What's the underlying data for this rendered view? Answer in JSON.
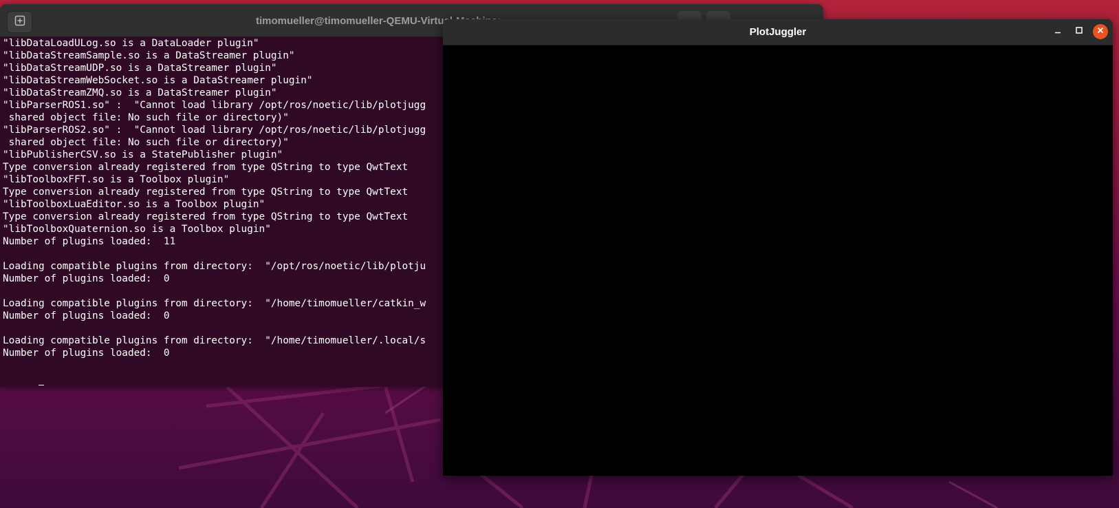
{
  "terminal": {
    "title": "timomueller@timomueller-QEMU-Virtual-Machine: ~",
    "lines": [
      "\"libDataLoadULog.so is a DataLoader plugin\"",
      "\"libDataStreamSample.so is a DataStreamer plugin\"",
      "\"libDataStreamUDP.so is a DataStreamer plugin\"",
      "\"libDataStreamWebSocket.so is a DataStreamer plugin\"",
      "\"libDataStreamZMQ.so is a DataStreamer plugin\"",
      "\"libParserROS1.so\" :  \"Cannot load library /opt/ros/noetic/lib/plotjugg",
      " shared object file: No such file or directory)\"",
      "\"libParserROS2.so\" :  \"Cannot load library /opt/ros/noetic/lib/plotjugg",
      " shared object file: No such file or directory)\"",
      "\"libPublisherCSV.so is a StatePublisher plugin\"",
      "Type conversion already registered from type QString to type QwtText",
      "\"libToolboxFFT.so is a Toolbox plugin\"",
      "Type conversion already registered from type QString to type QwtText",
      "\"libToolboxLuaEditor.so is a Toolbox plugin\"",
      "Type conversion already registered from type QString to type QwtText",
      "\"libToolboxQuaternion.so is a Toolbox plugin\"",
      "Number of plugins loaded:  11",
      "",
      "Loading compatible plugins from directory:  \"/opt/ros/noetic/lib/plotju",
      "Number of plugins loaded:  0",
      "",
      "Loading compatible plugins from directory:  \"/home/timomueller/catkin_w",
      "Number of plugins loaded:  0",
      "",
      "Loading compatible plugins from directory:  \"/home/timomueller/.local/s",
      "Number of plugins loaded:  0",
      ""
    ]
  },
  "plotjuggler": {
    "title": "PlotJuggler"
  },
  "icons": {
    "new_tab": "new-tab-icon",
    "search": "search-icon",
    "menu": "hamburger-menu-icon",
    "minimize": "minimize-icon",
    "maximize": "maximize-icon",
    "close": "close-icon"
  },
  "colors": {
    "terminal_bg": "#300a24",
    "close_button": "#e95420",
    "plot_area": "#000000"
  }
}
